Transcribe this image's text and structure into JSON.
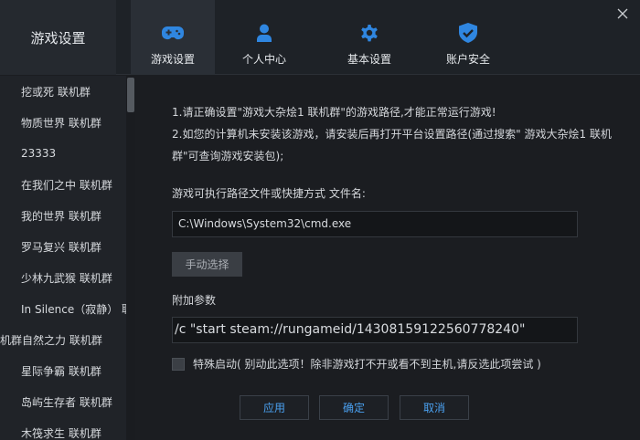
{
  "window": {
    "title": "游戏设置"
  },
  "tabs": [
    {
      "label": "游戏设置",
      "icon": "gamepad-icon",
      "active": true
    },
    {
      "label": "个人中心",
      "icon": "user-icon",
      "active": false
    },
    {
      "label": "基本设置",
      "icon": "gear-icon",
      "active": false
    },
    {
      "label": "账户安全",
      "icon": "shield-check-icon",
      "active": false
    }
  ],
  "sidebar": {
    "items": [
      {
        "label": "挖或死 联机群"
      },
      {
        "label": "物质世界 联机群"
      },
      {
        "label": "23333"
      },
      {
        "label": "在我们之中 联机群"
      },
      {
        "label": "我的世界 联机群"
      },
      {
        "label": "罗马复兴 联机群"
      },
      {
        "label": "少林九武猴 联机群"
      },
      {
        "label": "In Silence（寂静） 联"
      },
      {
        "label": "机群自然之力 联机群"
      },
      {
        "label": "星际争霸 联机群"
      },
      {
        "label": "岛屿生存者 联机群"
      },
      {
        "label": "木筏求生 联机群"
      }
    ]
  },
  "main": {
    "notice_line1": "1.请正确设置\"游戏大杂烩1 联机群\"的游戏路径,才能正常运行游戏!",
    "notice_line2": "2.如您的计算机未安装该游戏，请安装后再打开平台设置路径(通过搜索\" 游戏大杂烩1 联机群\"可查询游戏安装包);",
    "exe_label": "游戏可执行路径文件或快捷方式 文件名:",
    "exe_value": "C:\\Windows\\System32\\cmd.exe",
    "manual_button": "手动选择",
    "params_label": "附加参数",
    "params_value": "/c \"start steam://rungameid/14308159122560778240\"",
    "special_label": "特殊启动( 别动此选项！除非游戏打不开或看不到主机,请反选此项尝试 )",
    "special_checked": false
  },
  "footer": {
    "apply": "应用",
    "ok": "确定",
    "cancel": "取消"
  },
  "colors": {
    "accent": "#2f86e0",
    "button_text": "#4aa0f0"
  }
}
